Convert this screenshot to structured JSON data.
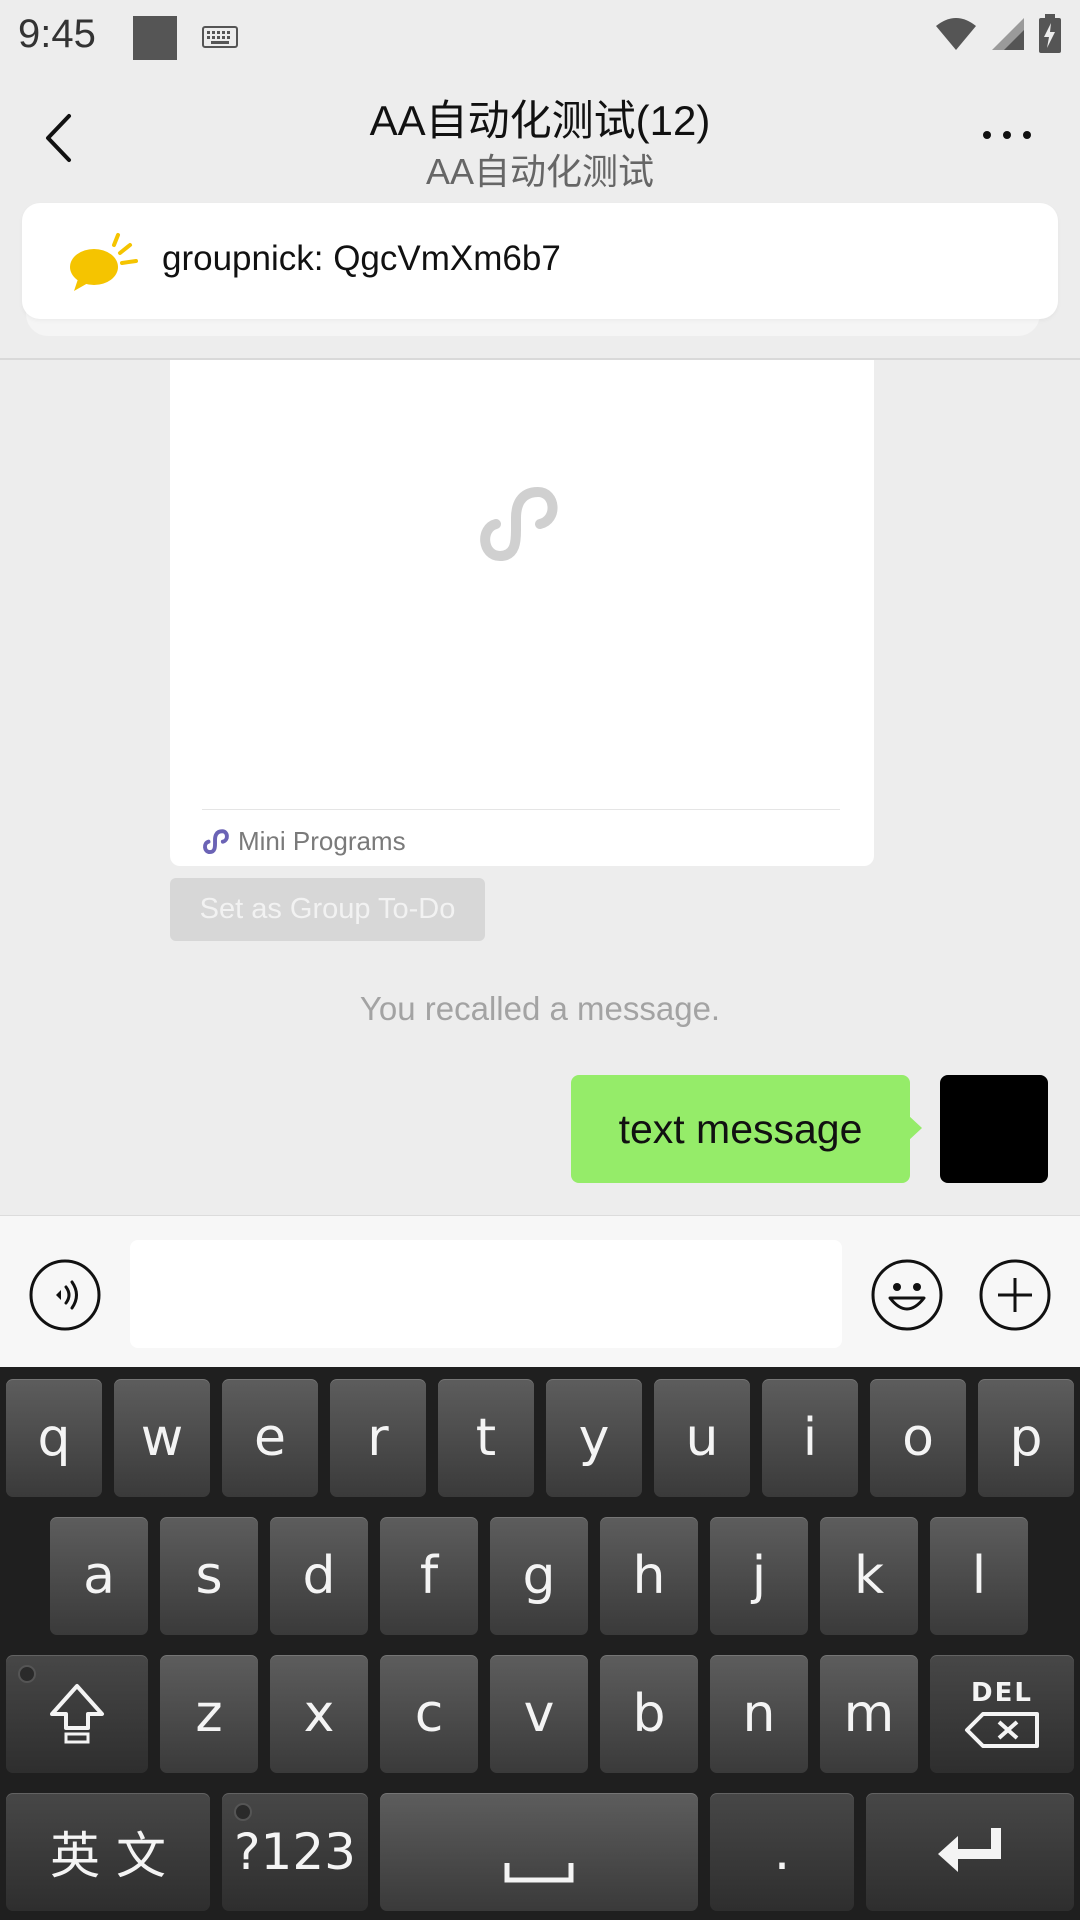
{
  "status_bar": {
    "time": "9:45"
  },
  "header": {
    "title": "AA自动化测试(12)",
    "subtitle": "AA自动化测试"
  },
  "notice": {
    "text": "groupnick: QgcVmXm6b7"
  },
  "mini_program_card": {
    "footer_label": "Mini Programs"
  },
  "todo_button": {
    "label": "Set as Group To-Do"
  },
  "system_message": {
    "text": "You recalled a message."
  },
  "message": {
    "text": "text message"
  },
  "input": {
    "placeholder": ""
  },
  "keyboard": {
    "row1": [
      "q",
      "w",
      "e",
      "r",
      "t",
      "y",
      "u",
      "i",
      "o",
      "p"
    ],
    "row2": [
      "a",
      "s",
      "d",
      "f",
      "g",
      "h",
      "j",
      "k",
      "l"
    ],
    "row3": [
      "z",
      "x",
      "c",
      "v",
      "b",
      "n",
      "m"
    ],
    "del_label": "DEL",
    "lang_label": "英 文",
    "symbols_label": "?123",
    "period_label": "."
  },
  "colors": {
    "background": "#ededed",
    "bubble": "#95ec69",
    "notice_icon": "#f5c400",
    "mini_program_accent": "#6b63b5"
  },
  "icons": [
    "back-arrow-icon",
    "more-icon",
    "notice-bubble-icon",
    "mini-program-icon",
    "voice-icon",
    "emoji-icon",
    "plus-icon",
    "shift-icon",
    "delete-icon",
    "space-icon",
    "enter-icon",
    "wifi-icon",
    "signal-icon",
    "battery-icon",
    "keyboard-icon"
  ]
}
